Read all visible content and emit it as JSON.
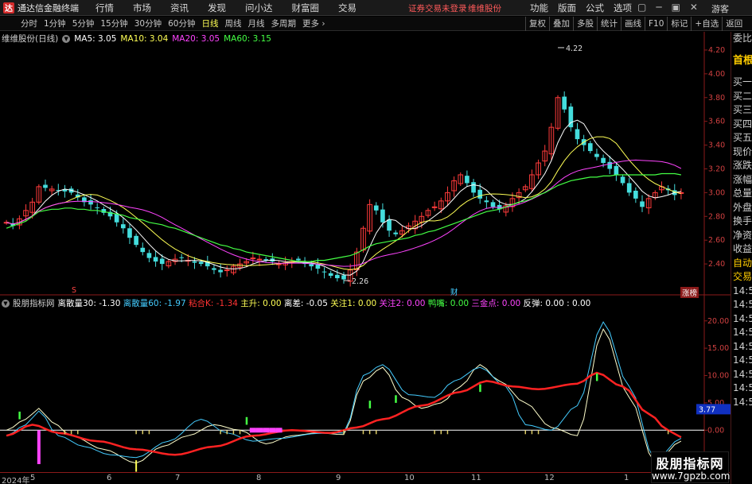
{
  "app": {
    "title": "通达信金融终端",
    "logo_char": "达",
    "menu": [
      "行情",
      "市场",
      "资讯",
      "发现",
      "问小达",
      "财富圈",
      "交易"
    ],
    "login_status": "证券交易未登录",
    "stock_name": "维维股份",
    "right_menu": [
      "功能",
      "版面",
      "公式",
      "选项"
    ],
    "window_controls": [
      "▢",
      "─",
      "▣",
      "✕"
    ],
    "guest": "游客"
  },
  "periods": {
    "items": [
      "分时",
      "1分钟",
      "5分钟",
      "15分钟",
      "30分钟",
      "60分钟",
      "日线",
      "周线",
      "月线",
      "多周期",
      "更多 ›"
    ],
    "active": "日线"
  },
  "tools": [
    "复权",
    "叠加",
    "多股",
    "统计",
    "画线",
    "F10",
    "标记",
    "+自选",
    "返回"
  ],
  "main_chart": {
    "name": "维维股份(日线)",
    "ma": [
      {
        "label": "MA5: 3.05",
        "color": "#ffffff"
      },
      {
        "label": "MA10: 3.04",
        "color": "#ffff55"
      },
      {
        "label": "MA20: 3.05",
        "color": "#ff44ff"
      },
      {
        "label": "MA60: 3.15",
        "color": "#44ff44"
      }
    ],
    "high_label": "4.22",
    "low_label": "2.26",
    "y_ticks": [
      "4.20",
      "4.00",
      "3.80",
      "3.60",
      "3.40",
      "3.20",
      "3.00",
      "2.80",
      "2.60",
      "2.40"
    ],
    "marker_s": "S",
    "marker_cai": "财",
    "zhangting": "涨榜"
  },
  "indicator": {
    "name": "股朋指标网",
    "items": [
      {
        "label": "离散量30: -1.30",
        "color": "#ffffff"
      },
      {
        "label": "离散量60: -1.97",
        "color": "#44ccff"
      },
      {
        "label": "粘合K: -1.34",
        "color": "#ff3333"
      },
      {
        "label": "主升: 0.00",
        "color": "#ffff55"
      },
      {
        "label": "离差: -0.05",
        "color": "#ffffff"
      },
      {
        "label": "关注1: 0.00",
        "color": "#ffff55"
      },
      {
        "label": "关注2: 0.00",
        "color": "#ff44ff"
      },
      {
        "label": "鸭嘴: 0.00",
        "color": "#44ff44"
      },
      {
        "label": "三金点: 0.00",
        "color": "#ff44ff"
      },
      {
        "label": "反弹: 0.00",
        "color": "#ffffff"
      },
      {
        "label": ": 0.00",
        "color": "#ffffff"
      }
    ],
    "y_ticks": [
      "20.00",
      "15.00",
      "10.00",
      "5.00",
      "0.00",
      "-5.00"
    ],
    "current_value": "3.77"
  },
  "side_panel": [
    "委比",
    "首根",
    "买一",
    "买二",
    "买三",
    "买四",
    "买五",
    "现价",
    "涨跌",
    "涨幅",
    "总量",
    "外盘",
    "换手",
    "净资",
    "收益",
    "自动",
    "交易",
    "14:56",
    "14:56",
    "14:56",
    "14:56",
    "14:56",
    "14:56",
    "14:56",
    "14:56",
    "14:56"
  ],
  "x_axis": [
    "2024年",
    "5",
    "6",
    "7",
    "8",
    "9",
    "10",
    "11",
    "12",
    "1"
  ],
  "watermark": {
    "line1": "股朋指标网",
    "line2": "www.7gpzb.com"
  },
  "colors": {
    "up": "#ff3b3b",
    "down": "#44dddd",
    "ma5": "#ffffff",
    "ma10": "#ffff55",
    "ma20": "#ff44ff",
    "ma60": "#44ff44"
  },
  "chart_data": {
    "type": "candlestick",
    "y_range": [
      2.2,
      4.3
    ],
    "close": [
      2.75,
      2.72,
      2.78,
      2.85,
      2.92,
      3.05,
      3.04,
      3.03,
      3.02,
      3.01,
      3.0,
      2.96,
      2.92,
      2.9,
      2.87,
      2.83,
      2.8,
      2.75,
      2.7,
      2.62,
      2.56,
      2.5,
      2.45,
      2.42,
      2.4,
      2.42,
      2.44,
      2.45,
      2.43,
      2.41,
      2.4,
      2.38,
      2.35,
      2.33,
      2.35,
      2.38,
      2.4,
      2.42,
      2.45,
      2.44,
      2.43,
      2.42,
      2.4,
      2.41,
      2.42,
      2.43,
      2.4,
      2.38,
      2.36,
      2.33,
      2.3,
      2.28,
      2.27,
      2.35,
      2.5,
      2.7,
      2.9,
      2.85,
      2.75,
      2.68,
      2.65,
      2.68,
      2.72,
      2.76,
      2.8,
      2.85,
      2.88,
      2.93,
      3.0,
      3.1,
      3.15,
      3.08,
      3.0,
      2.95,
      2.92,
      2.88,
      2.86,
      2.89,
      2.95,
      3.0,
      3.05,
      3.15,
      3.25,
      3.35,
      3.55,
      3.8,
      3.7,
      3.55,
      3.45,
      3.4,
      3.35,
      3.3,
      3.25,
      3.2,
      3.15,
      3.08,
      3.0,
      2.95,
      2.88,
      2.95,
      3.0,
      3.05,
      3.02,
      2.98,
      3.0
    ],
    "ma60": [
      2.7,
      2.72,
      2.74,
      2.76,
      2.8,
      2.84,
      2.85,
      2.86,
      2.86,
      2.87,
      2.87,
      2.86,
      2.86,
      2.85,
      2.85,
      2.84,
      2.83,
      2.82,
      2.81,
      2.79,
      2.78,
      2.77,
      2.75,
      2.74,
      2.73,
      2.71,
      2.7,
      2.68,
      2.66,
      2.64,
      2.62,
      2.6,
      2.58,
      2.56,
      2.55,
      2.53,
      2.52,
      2.5,
      2.49,
      2.48,
      2.47,
      2.46,
      2.45,
      2.44,
      2.43,
      2.42,
      2.42,
      2.42,
      2.43,
      2.43,
      2.44,
      2.45,
      2.46,
      2.47,
      2.49,
      2.52,
      2.55,
      2.57,
      2.58,
      2.59,
      2.6,
      2.61,
      2.62,
      2.64,
      2.65,
      2.67,
      2.68,
      2.7,
      2.72,
      2.74,
      2.76,
      2.78,
      2.8,
      2.82,
      2.84,
      2.85,
      2.86,
      2.88,
      2.9,
      2.92,
      2.93,
      2.95,
      2.98,
      3.0,
      3.03,
      3.06,
      3.08,
      3.1,
      3.11,
      3.12,
      3.13,
      3.13,
      3.14,
      3.14,
      3.15,
      3.15,
      3.15,
      3.15,
      3.15,
      3.15,
      3.15,
      3.16,
      3.16,
      3.16,
      3.15
    ]
  }
}
